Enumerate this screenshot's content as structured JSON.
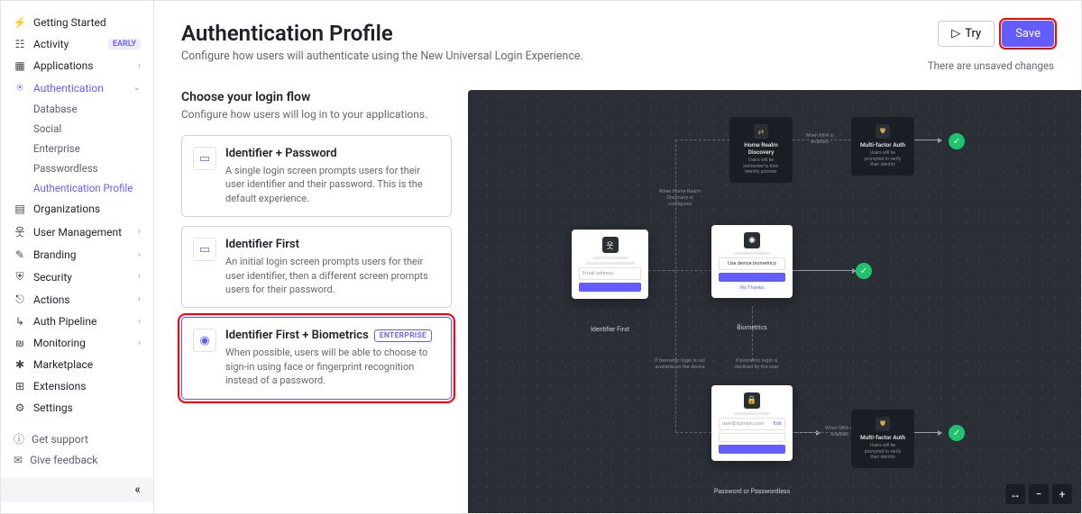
{
  "sidebar": {
    "items": [
      {
        "label": "Getting Started",
        "icon": "⚡"
      },
      {
        "label": "Activity",
        "icon": "☷",
        "badge": "EARLY"
      },
      {
        "label": "Applications",
        "icon": "▦",
        "expandable": true
      },
      {
        "label": "Authentication",
        "icon": "⍟",
        "expandable": true,
        "active": true
      },
      {
        "label": "Organizations",
        "icon": "▤"
      },
      {
        "label": "User Management",
        "icon": "웃",
        "expandable": true
      },
      {
        "label": "Branding",
        "icon": "✎",
        "expandable": true
      },
      {
        "label": "Security",
        "icon": "⛨",
        "expandable": true
      },
      {
        "label": "Actions",
        "icon": "⎋",
        "expandable": true
      },
      {
        "label": "Auth Pipeline",
        "icon": "↳",
        "expandable": true
      },
      {
        "label": "Monitoring",
        "icon": "₪",
        "expandable": true
      },
      {
        "label": "Marketplace",
        "icon": "✱"
      },
      {
        "label": "Extensions",
        "icon": "⊞"
      },
      {
        "label": "Settings",
        "icon": "⚙"
      }
    ],
    "auth_sub": [
      {
        "label": "Database"
      },
      {
        "label": "Social"
      },
      {
        "label": "Enterprise"
      },
      {
        "label": "Passwordless"
      },
      {
        "label": "Authentication Profile",
        "active": true
      }
    ],
    "footer": [
      {
        "label": "Get support",
        "icon": "?"
      },
      {
        "label": "Give feedback",
        "icon": "✉"
      }
    ]
  },
  "header": {
    "title": "Authentication Profile",
    "subtitle": "Configure how users will authenticate using the New Universal Login Experience.",
    "try_label": "Try",
    "save_label": "Save",
    "unsaved": "There are unsaved changes"
  },
  "flow": {
    "heading": "Choose your login flow",
    "desc": "Configure how users will log in to your applications.",
    "options": [
      {
        "title": "Identifier + Password",
        "desc": "A single login screen prompts users for their user identifier and their password. This is the default experience.",
        "icon": "▭"
      },
      {
        "title": "Identifier First",
        "desc": "An initial login screen prompts users for their user identifier, then a different screen prompts users for their password.",
        "icon": "▭"
      },
      {
        "title": "Identifier First + Biometrics",
        "desc": "When possible, users will be able to choose to sign-in using face or fingerprint recognition instead of a password.",
        "icon": "◉",
        "badge": "ENTERPRISE",
        "selected": true
      }
    ]
  },
  "preview": {
    "identifier_first": {
      "label": "Identifier First",
      "placeholder": "Email address"
    },
    "biometrics": {
      "label": "Biometrics",
      "cta": "Use device biometrics",
      "no_thanks": "No Thanks"
    },
    "password": {
      "label": "Password or Passwordless",
      "value": "user@domain.com",
      "edit": "Edit"
    },
    "hrd": {
      "title": "Home Realm Discovery",
      "desc": "Users will be redirected to their identity provider"
    },
    "mfa": {
      "title": "Multi-factor Auth",
      "desc": "Users will be prompted to verify their identity"
    },
    "notes": {
      "hrd_cond": "When Home Realm Discovery is configured",
      "mfa_cond": "When MFA is enabled",
      "bio_na": "If biometric login is not available on the device",
      "bio_declined": "If biometric login is declined by the user"
    }
  }
}
